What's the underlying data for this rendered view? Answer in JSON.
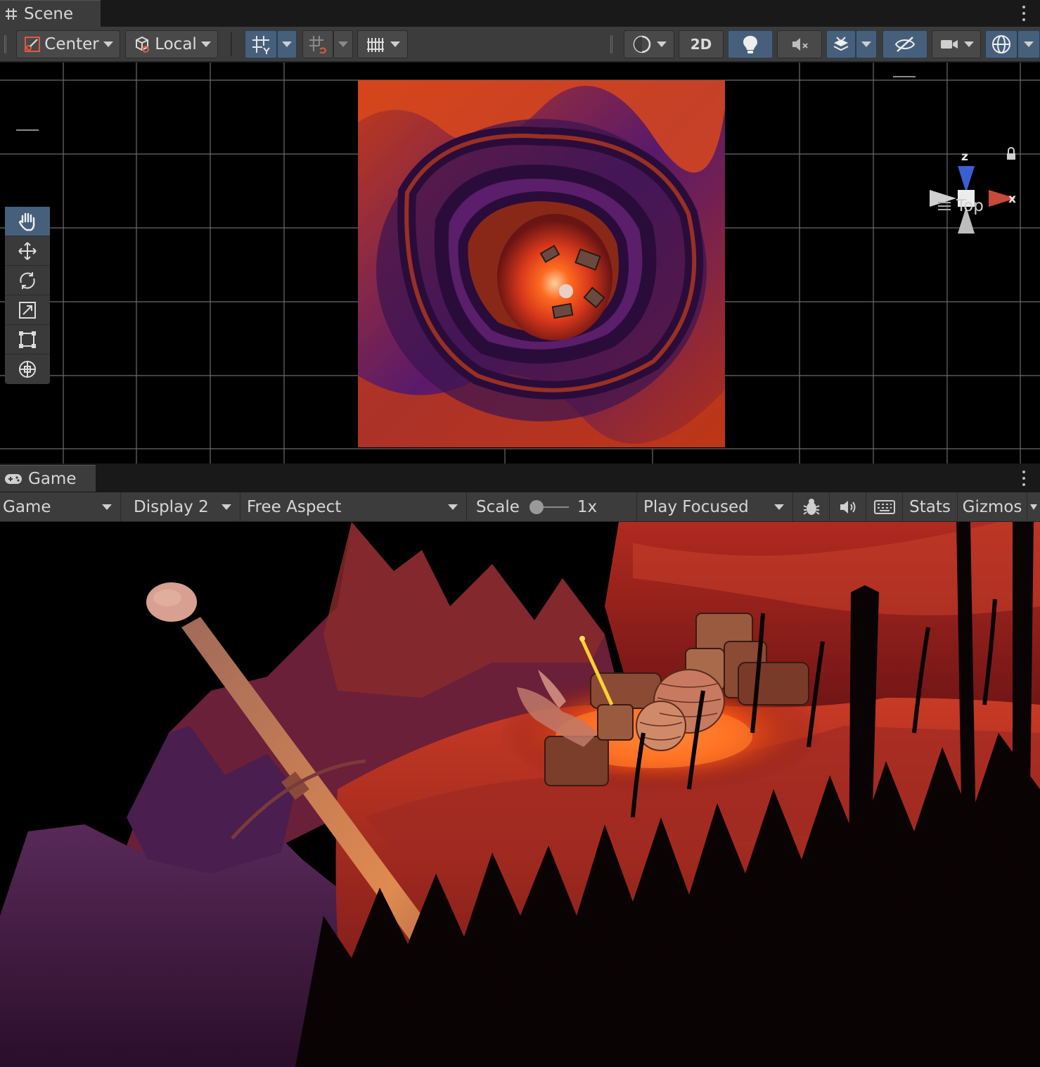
{
  "scene": {
    "tab_label": "Scene",
    "toolbar": {
      "pivot_label": "Center",
      "space_label": "Local",
      "toggle_2d_label": "2D"
    },
    "tools": [
      {
        "name": "hand-tool-icon",
        "active": true
      },
      {
        "name": "move-tool-icon",
        "active": false
      },
      {
        "name": "rotate-tool-icon",
        "active": false
      },
      {
        "name": "scale-tool-icon",
        "active": false
      },
      {
        "name": "rect-tool-icon",
        "active": false
      },
      {
        "name": "transform-tool-icon",
        "active": false
      }
    ],
    "gizmo": {
      "axis_z": "z",
      "axis_x": "x",
      "view_label": "Top"
    }
  },
  "game": {
    "tab_label": "Game",
    "toolbar": {
      "view_dropdown": "Game",
      "display_dropdown": "Display 2",
      "aspect_dropdown": "Free Aspect",
      "scale_label": "Scale",
      "scale_value": "1x",
      "scale_level": 0,
      "play_mode_dropdown": "Play Focused",
      "stats_label": "Stats",
      "gizmos_label": "Gizmos"
    }
  },
  "colors": {
    "accent_active": "#46607c",
    "panel": "#3c3c3c",
    "lava": "#ff5a14",
    "rock_purple": "#4a1a6a"
  }
}
